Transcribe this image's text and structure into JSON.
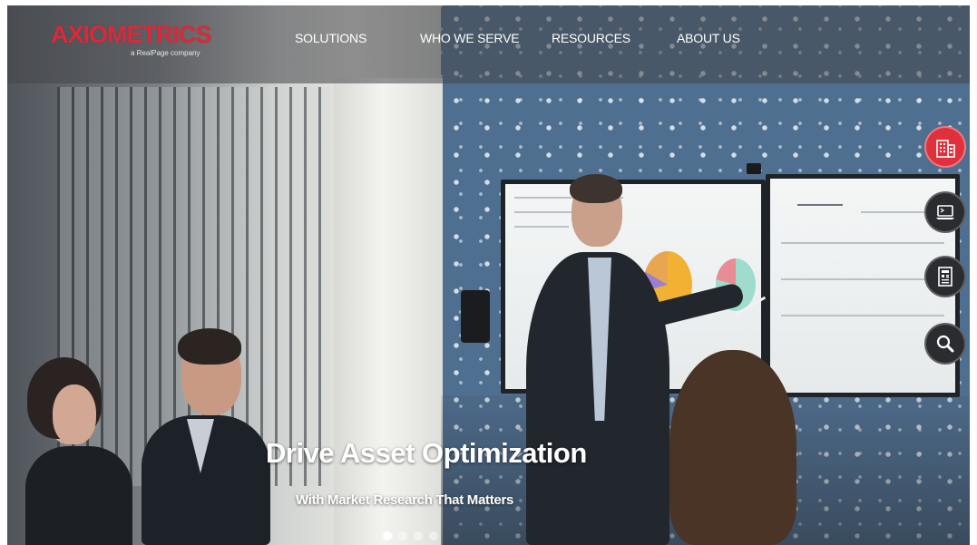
{
  "brand": {
    "logo_text": "AXIOMETRICS",
    "logo_tagline": "a RealPage company",
    "accent_color": "#d82a3a"
  },
  "nav": {
    "items": [
      {
        "label": "SOLUTIONS"
      },
      {
        "label": "WHO WE SERVE"
      },
      {
        "label": "RESOURCES"
      },
      {
        "label": "ABOUT US"
      }
    ]
  },
  "side_icons": [
    {
      "icon": "building-icon",
      "active": true
    },
    {
      "icon": "laptop-icon",
      "active": false
    },
    {
      "icon": "newspaper-icon",
      "active": false
    },
    {
      "icon": "search-icon",
      "active": false
    }
  ],
  "hero": {
    "title": "Drive Asset Optimization",
    "subtitle": "With Market Research That Matters"
  },
  "carousel": {
    "slide_count": 4,
    "active_index": 0
  }
}
